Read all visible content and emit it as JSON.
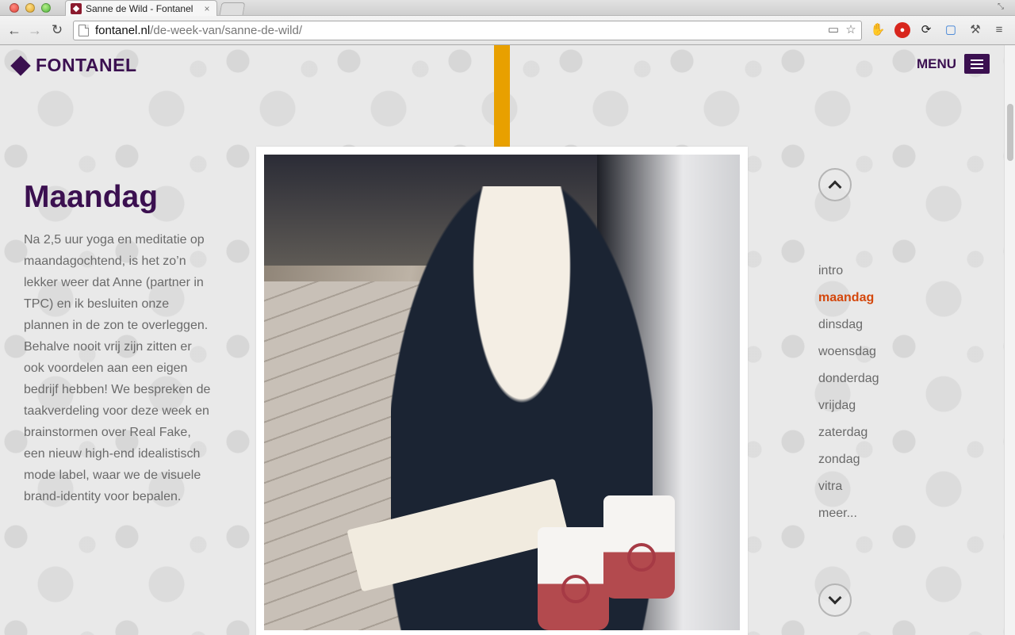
{
  "browser": {
    "tab_title": "Sanne de Wild - Fontanel",
    "tab_close": "×",
    "url_domain": "fontanel.nl",
    "url_path": "/de-week-van/sanne-de-wild/"
  },
  "site": {
    "logo_text": "FONTANEL",
    "menu_label": "MENU",
    "accent_color": "#3b1050",
    "highlight_color": "#d4470c",
    "bar_color": "#e8a000"
  },
  "article": {
    "title": "Maandag",
    "body": "Na 2,5 uur yoga en meditatie op maandagochtend, is het zo’n lekker weer dat Anne (partner in TPC) en ik besluiten onze plannen in de zon te overleggen. Behalve nooit vrij zijn zitten er ook voordelen aan een eigen bedrijf hebben! We bespreken de taakverdeling voor deze week en brainstormen over Real Fake, een nieuw high-end idealistisch mode label, waar we de visuele brand-identity voor bepalen."
  },
  "day_nav": {
    "items": [
      {
        "label": "intro"
      },
      {
        "label": "maandag"
      },
      {
        "label": "dinsdag"
      },
      {
        "label": "woensdag"
      },
      {
        "label": "donderdag"
      },
      {
        "label": "vrijdag"
      },
      {
        "label": "zaterdag"
      },
      {
        "label": "zondag"
      },
      {
        "label": "vitra"
      },
      {
        "label": "meer..."
      }
    ],
    "active": "maandag"
  }
}
